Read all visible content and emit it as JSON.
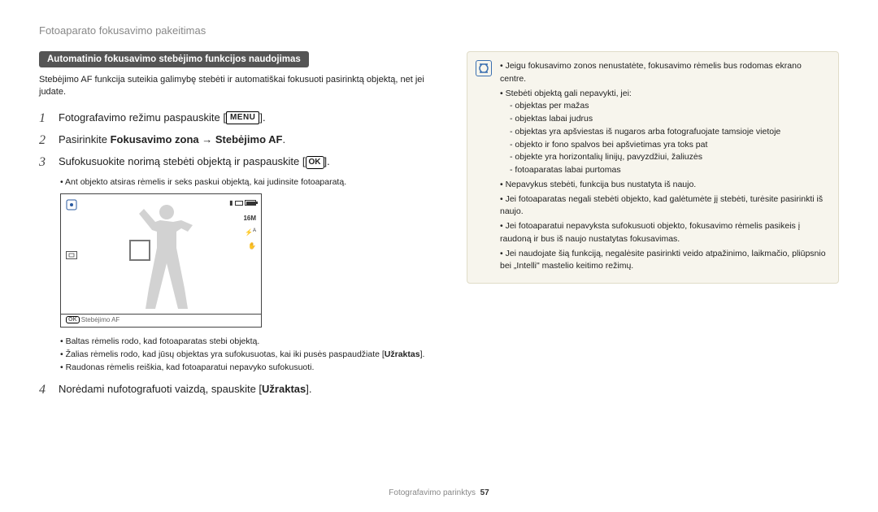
{
  "header": "Fotoaparato fokusavimo pakeitimas",
  "section_title": "Automatinio fokusavimo stebėjimo funkcijos naudojimas",
  "intro": "Stebėjimo AF funkcija suteikia galimybę stebėti ir automatiškai fokusuoti pasirinktą objektą, net jei judate.",
  "steps": {
    "s1_pre": "Fotografavimo režimu paspauskite [",
    "s1_menu": "MENU",
    "s1_post": "].",
    "s2_pre": "Pasirinkite ",
    "s2_bold": "Fokusavimo zona → Stebėjimo AF",
    "s2_post": ".",
    "s3_pre": "Sufokusuokite norimą stebėti objektą ir paspauskite [",
    "s3_ok": "OK",
    "s3_post": "].",
    "s3_sub": "Ant objekto atsiras rėmelis ir seks paskui objektą, kai judinsite fotoaparatą.",
    "s4_pre": "Norėdami nufotografuoti vaizdą, spauskite [",
    "s4_bold": "Užraktas",
    "s4_post": "]."
  },
  "lcd": {
    "ok_label": "OK",
    "footer_text": "Stebėjimo AF",
    "icon_16m": "16M",
    "icon_flash": "⚡",
    "icon_hand": "✋"
  },
  "frame_bullets": [
    "Baltas rėmelis rodo, kad fotoaparatas stebi objektą.",
    "Žalias rėmelis rodo, kad jūsų objektas yra sufokusuotas, kai iki pusės paspaudžiate [",
    "Raudonas rėmelis reiškia, kad fotoaparatui nepavyko sufokusuoti."
  ],
  "frame_bullet2_bold": "Užraktas",
  "frame_bullet2_post": "].",
  "note": {
    "b1": "Jeigu fokusavimo zonos nenustatėte, fokusavimo rėmelis bus rodomas ekrano centre.",
    "b2": "Stebėti objektą gali nepavykti, jei:",
    "b2_sub": [
      "objektas per mažas",
      "objektas labai judrus",
      "objektas yra apšviestas iš nugaros arba fotografuojate tamsioje vietoje",
      "objekto ir fono spalvos bei apšvietimas yra toks pat",
      "objekte yra horizontalių linijų, pavyzdžiui, žaliuzės",
      "fotoaparatas labai purtomas"
    ],
    "b3": "Nepavykus stebėti, funkcija bus nustatyta iš naujo.",
    "b4": "Jei fotoaparatas negali stebėti objekto, kad galėtumėte jį stebėti, turėsite pasirinkti iš naujo.",
    "b5": "Jei fotoaparatui nepavyksta sufokusuoti objekto, fokusavimo rėmelis pasikeis į raudoną ir bus iš naujo nustatytas fokusavimas.",
    "b6": "Jei naudojate šią funkciją, negalėsite pasirinkti veido atpažinimo, laikmačio, pliūpsnio bei „Intelli\" mastelio keitimo režimų."
  },
  "footer": {
    "label": "Fotografavimo parinktys",
    "page": "57"
  }
}
